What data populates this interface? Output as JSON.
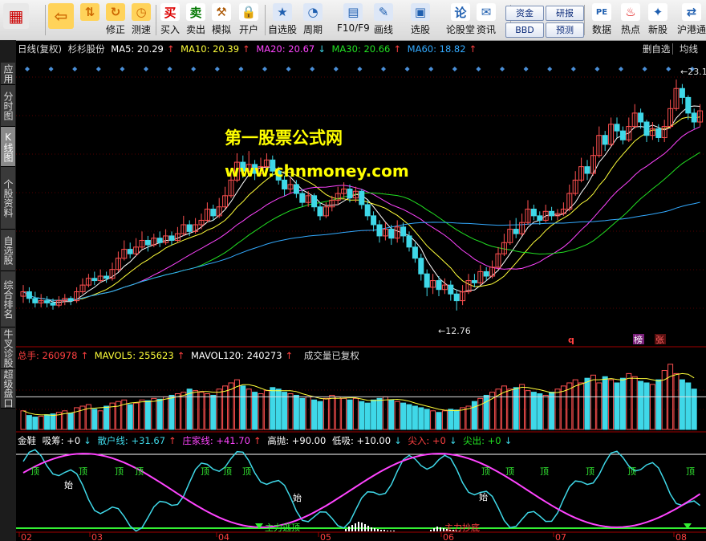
{
  "colors": {
    "up": "#ff5050",
    "down": "#3fd8e8",
    "ma5": "#ffffff",
    "ma10": "#ffff3a",
    "ma20": "#ff44ff",
    "ma30": "#22e022",
    "ma60": "#33aaff",
    "text_red": "#ff4040"
  },
  "toolbar": {
    "buttons": [
      {
        "label": "",
        "icon": "windows-icon"
      },
      {
        "label": "",
        "icon": "back-arrow-icon"
      },
      {
        "label": "",
        "icon": "up-down-arrows-icon"
      },
      {
        "label": "修正",
        "icon": "refresh-icon"
      },
      {
        "label": "测速",
        "icon": "clock-icon"
      },
      {
        "label": "买入",
        "icon": "buy-icon",
        "glyph": "买"
      },
      {
        "label": "卖出",
        "icon": "sell-icon",
        "glyph": "卖"
      },
      {
        "label": "模拟",
        "icon": "hammer-icon"
      },
      {
        "label": "开户",
        "icon": "lock-icon"
      },
      {
        "label": "自选股",
        "icon": "star-icon"
      },
      {
        "label": "周期",
        "icon": "period-icon"
      },
      {
        "label": "F10/F9",
        "icon": "f10-icon"
      },
      {
        "label": "画线",
        "icon": "pencil-icon"
      },
      {
        "label": "选股",
        "icon": "monitor-icon"
      },
      {
        "label": "论股堂",
        "icon": "lun-icon",
        "glyph": "论"
      },
      {
        "label": "资讯",
        "icon": "news-icon"
      },
      {
        "label": "数据",
        "icon": "pe-icon",
        "glyph": "PE"
      },
      {
        "label": "热点",
        "icon": "hot-icon"
      },
      {
        "label": "新股",
        "icon": "ipo-icon"
      },
      {
        "label": "沪港通",
        "icon": "sse-hkex-icon"
      }
    ],
    "small_buttons": [
      "资金",
      "BBD",
      "研报",
      "预测"
    ]
  },
  "side_tabs": [
    "应用",
    "分时图",
    "K线图",
    "个股资料",
    "自选股",
    "综合排名",
    "牛叉诊股",
    "超级盘口"
  ],
  "header": {
    "period_label": "日线(复权)",
    "stock_name": "杉杉股份",
    "ma5": "MA5: 20.29",
    "ma10": "MA10: 20.39",
    "ma20": "MA20: 20.67",
    "ma30": "MA30: 20.66",
    "ma60": "MA60: 18.82",
    "right_a": "删自选",
    "right_b": "均线"
  },
  "watermark": {
    "line1": "第一股票公式网",
    "line2": "www.chnmoney.com"
  },
  "price_labels": {
    "high": "23.1",
    "low": "12.76"
  },
  "markers": {
    "q": "q",
    "bang": "榜",
    "zhang": "张"
  },
  "volume_header": {
    "total": "总手: 260978",
    "mavol5": "MAVOL5: 255623",
    "mavol120": "MAVOL120: 240273",
    "note": "成交量已复权"
  },
  "indicator_header": {
    "name": "金鞋",
    "xichou": "吸筹: +0",
    "sanhu": "散户线: +31.67",
    "zhuangjia": "庄家线: +41.70",
    "gaopao": "高抛: +90.00",
    "dixi": "低吸: +10.00",
    "jianru": "尖入: +0",
    "jianchu": "尖出: +0"
  },
  "indicator_labels": {
    "top": "顶",
    "bottom": "始",
    "zhuli_tao": "主力逃顶",
    "zhuli_chao": "主力抄底"
  },
  "x_axis": [
    "02",
    "03",
    "04",
    "05",
    "06",
    "07",
    "08"
  ],
  "chart_data": {
    "type": "candlestick",
    "price_range": [
      12.0,
      23.5
    ],
    "candles": [
      [
        13.4,
        13.6,
        13.9,
        13.1
      ],
      [
        13.6,
        13.3,
        13.8,
        13.1
      ],
      [
        13.3,
        13.1,
        13.6,
        12.9
      ],
      [
        13.1,
        13.2,
        13.5,
        12.9
      ],
      [
        13.2,
        13.1,
        13.4,
        12.9
      ],
      [
        13.1,
        13.0,
        13.3,
        12.8
      ],
      [
        13.0,
        13.2,
        13.4,
        12.9
      ],
      [
        13.2,
        13.3,
        13.5,
        13.0
      ],
      [
        13.3,
        13.2,
        13.4,
        13.0
      ],
      [
        13.2,
        13.6,
        13.8,
        13.1
      ],
      [
        13.6,
        13.9,
        14.2,
        13.5
      ],
      [
        13.9,
        14.2,
        14.4,
        13.8
      ],
      [
        14.2,
        14.1,
        14.5,
        13.9
      ],
      [
        14.1,
        14.3,
        14.6,
        14.0
      ],
      [
        14.3,
        14.2,
        14.5,
        14.0
      ],
      [
        14.2,
        14.6,
        14.9,
        14.1
      ],
      [
        14.6,
        15.1,
        15.4,
        14.5
      ],
      [
        15.1,
        15.5,
        15.9,
        15.0
      ],
      [
        15.5,
        15.3,
        15.8,
        15.1
      ],
      [
        15.3,
        15.6,
        16.0,
        15.2
      ],
      [
        15.6,
        15.9,
        16.3,
        15.5
      ],
      [
        15.9,
        15.7,
        16.1,
        15.4
      ],
      [
        15.7,
        16.0,
        16.2,
        15.6
      ],
      [
        16.0,
        15.8,
        16.3,
        15.6
      ],
      [
        15.8,
        16.1,
        16.4,
        15.7
      ],
      [
        16.1,
        15.9,
        16.3,
        15.7
      ],
      [
        15.9,
        16.2,
        16.5,
        15.8
      ],
      [
        16.2,
        16.6,
        17.0,
        16.1
      ],
      [
        16.6,
        16.3,
        16.8,
        16.1
      ],
      [
        16.3,
        16.6,
        16.9,
        16.2
      ],
      [
        16.6,
        16.8,
        17.1,
        16.4
      ],
      [
        16.8,
        17.3,
        17.6,
        16.7
      ],
      [
        17.3,
        17.0,
        17.5,
        16.8
      ],
      [
        17.0,
        17.4,
        17.8,
        16.9
      ],
      [
        17.4,
        17.9,
        18.3,
        17.3
      ],
      [
        17.9,
        18.6,
        19.0,
        17.8
      ],
      [
        18.6,
        19.4,
        19.8,
        18.5
      ],
      [
        19.4,
        19.0,
        19.7,
        18.7
      ],
      [
        19.0,
        19.3,
        19.9,
        18.9
      ],
      [
        19.3,
        18.9,
        19.5,
        18.6
      ],
      [
        18.9,
        19.2,
        19.6,
        18.8
      ],
      [
        19.2,
        19.5,
        19.8,
        19.0
      ],
      [
        19.5,
        19.0,
        19.7,
        18.8
      ],
      [
        19.0,
        18.6,
        19.2,
        18.4
      ],
      [
        18.6,
        18.2,
        18.8,
        17.9
      ],
      [
        18.2,
        18.4,
        18.7,
        18.0
      ],
      [
        18.4,
        18.0,
        18.6,
        17.8
      ],
      [
        18.0,
        17.6,
        18.2,
        17.4
      ],
      [
        17.6,
        17.9,
        18.1,
        17.4
      ],
      [
        17.9,
        17.4,
        18.0,
        17.2
      ],
      [
        17.4,
        17.0,
        17.6,
        16.8
      ],
      [
        17.0,
        17.4,
        17.6,
        16.9
      ],
      [
        17.4,
        17.7,
        17.9,
        17.2
      ],
      [
        17.7,
        18.0,
        18.3,
        17.5
      ],
      [
        18.0,
        18.2,
        18.5,
        17.8
      ],
      [
        18.2,
        17.8,
        18.4,
        17.6
      ],
      [
        17.8,
        18.1,
        18.3,
        17.6
      ],
      [
        18.1,
        17.5,
        18.2,
        17.3
      ],
      [
        17.5,
        17.0,
        17.7,
        16.8
      ],
      [
        17.0,
        16.6,
        17.2,
        16.3
      ],
      [
        16.6,
        16.1,
        16.8,
        15.8
      ],
      [
        16.1,
        16.4,
        16.7,
        15.9
      ],
      [
        16.4,
        16.0,
        16.6,
        15.7
      ],
      [
        16.0,
        16.5,
        16.8,
        15.8
      ],
      [
        16.5,
        16.1,
        16.7,
        15.8
      ],
      [
        16.1,
        15.6,
        16.3,
        15.4
      ],
      [
        15.6,
        15.1,
        15.8,
        14.9
      ],
      [
        15.1,
        14.4,
        15.3,
        14.1
      ],
      [
        14.4,
        13.8,
        14.6,
        13.4
      ],
      [
        13.8,
        14.1,
        14.4,
        13.5
      ],
      [
        14.1,
        13.7,
        14.3,
        13.4
      ],
      [
        13.7,
        13.9,
        14.2,
        13.5
      ],
      [
        13.9,
        13.5,
        14.1,
        13.2
      ],
      [
        13.5,
        13.2,
        13.7,
        12.76
      ],
      [
        13.2,
        13.6,
        13.9,
        13.0
      ],
      [
        13.6,
        14.1,
        14.4,
        13.5
      ],
      [
        14.1,
        14.0,
        14.4,
        13.8
      ],
      [
        14.0,
        14.5,
        14.8,
        13.9
      ],
      [
        14.5,
        14.3,
        14.7,
        14.1
      ],
      [
        14.3,
        14.7,
        15.0,
        14.2
      ],
      [
        14.7,
        15.3,
        15.6,
        14.6
      ],
      [
        15.3,
        15.8,
        16.2,
        15.2
      ],
      [
        15.8,
        16.4,
        16.8,
        15.7
      ],
      [
        16.4,
        16.2,
        16.9,
        16.0
      ],
      [
        16.2,
        16.7,
        17.1,
        16.1
      ],
      [
        16.7,
        17.3,
        17.7,
        16.6
      ],
      [
        17.3,
        17.0,
        17.5,
        16.8
      ],
      [
        17.0,
        16.8,
        17.2,
        16.6
      ],
      [
        16.8,
        17.2,
        17.5,
        16.7
      ],
      [
        17.2,
        17.0,
        17.4,
        16.8
      ],
      [
        17.0,
        17.1,
        17.3,
        16.8
      ],
      [
        17.1,
        17.3,
        17.6,
        17.0
      ],
      [
        17.3,
        18.0,
        18.4,
        17.2
      ],
      [
        18.0,
        18.6,
        19.0,
        17.9
      ],
      [
        18.6,
        19.2,
        19.6,
        18.5
      ],
      [
        19.2,
        18.9,
        19.5,
        18.6
      ],
      [
        18.9,
        19.7,
        20.1,
        18.8
      ],
      [
        19.7,
        20.6,
        21.0,
        19.6
      ],
      [
        20.6,
        20.2,
        20.8,
        19.9
      ],
      [
        20.2,
        21.1,
        21.4,
        20.1
      ],
      [
        21.1,
        20.8,
        21.4,
        20.5
      ],
      [
        20.8,
        20.4,
        21.0,
        20.2
      ],
      [
        20.4,
        21.0,
        21.4,
        20.3
      ],
      [
        21.0,
        21.6,
        22.0,
        20.9
      ],
      [
        21.6,
        21.2,
        21.8,
        20.9
      ],
      [
        21.2,
        20.6,
        21.3,
        20.3
      ],
      [
        20.6,
        20.9,
        21.2,
        20.4
      ],
      [
        20.9,
        20.5,
        21.1,
        20.3
      ],
      [
        20.5,
        21.0,
        21.3,
        20.3
      ],
      [
        21.0,
        21.8,
        22.2,
        20.9
      ],
      [
        21.8,
        22.7,
        23.1,
        21.7
      ],
      [
        22.7,
        22.3,
        22.9,
        22.0
      ],
      [
        22.3,
        21.6,
        22.4,
        21.3
      ],
      [
        21.6,
        21.2,
        21.8,
        20.9
      ],
      [
        21.2,
        21.7,
        22.0,
        21.0
      ]
    ],
    "volume": [
      120,
      90,
      80,
      85,
      95,
      100,
      110,
      120,
      105,
      140,
      150,
      160,
      130,
      120,
      150,
      170,
      180,
      190,
      160,
      170,
      190,
      185,
      200,
      195,
      210,
      220,
      230,
      240,
      260,
      250,
      240,
      230,
      220,
      260,
      280,
      300,
      320,
      280,
      260,
      240,
      230,
      250,
      270,
      260,
      240,
      230,
      220,
      200,
      210,
      190,
      180,
      200,
      220,
      210,
      200,
      190,
      200,
      180,
      170,
      190,
      200,
      210,
      190,
      180,
      170,
      160,
      150,
      140,
      130,
      120,
      110,
      120,
      130,
      125,
      140,
      150,
      180,
      200,
      220,
      240,
      260,
      280,
      260,
      270,
      290,
      250,
      240,
      230,
      220,
      240,
      260,
      280,
      300,
      320,
      300,
      330,
      350,
      300,
      340,
      320,
      300,
      330,
      360,
      340,
      310,
      300,
      290,
      320,
      380,
      420,
      360,
      320,
      300,
      260
    ]
  }
}
